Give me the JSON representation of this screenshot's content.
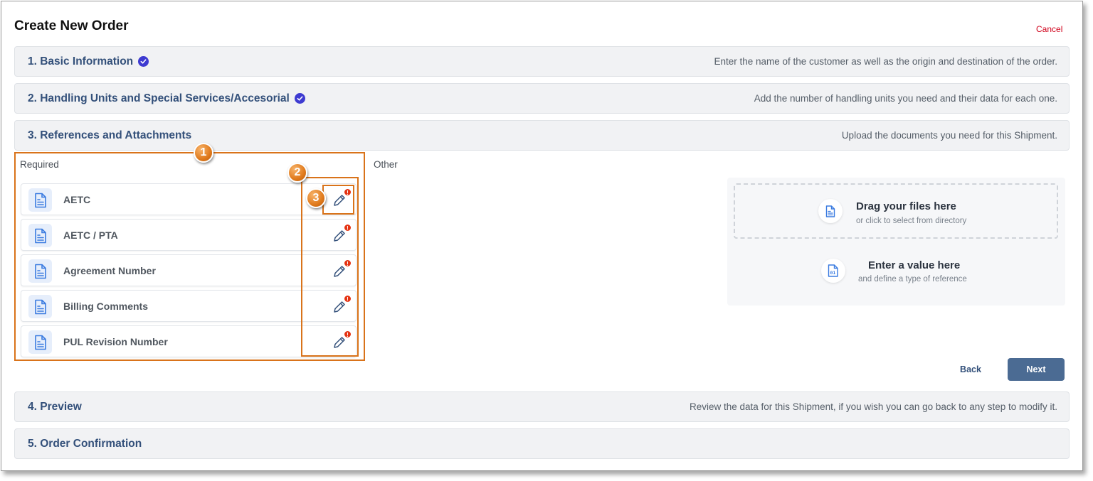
{
  "header": {
    "title": "Create New Order",
    "cancel_label": "Cancel"
  },
  "steps": [
    {
      "label": "1. Basic Information",
      "description": "Enter the name of the customer as well as the origin and destination of the order.",
      "completed": true
    },
    {
      "label": "2. Handling Units and Special Services/Accesorial",
      "description": "Add the number of handling units you need and their data for each one.",
      "completed": true
    },
    {
      "label": "3. References and Attachments",
      "description": "Upload the documents you need for this Shipment.",
      "completed": false
    },
    {
      "label": "4. Preview",
      "description": "Review the data for this Shipment, if you wish you can go back to any step to modify it.",
      "completed": false
    },
    {
      "label": "5. Order Confirmation",
      "description": "",
      "completed": false
    }
  ],
  "required": {
    "label": "Required",
    "items": [
      {
        "label": "AETC",
        "icon": "document-icon",
        "alert": "!"
      },
      {
        "label": "AETC / PTA",
        "icon": "document-icon",
        "alert": "!"
      },
      {
        "label": "Agreement Number",
        "icon": "document-icon",
        "alert": "!"
      },
      {
        "label": "Billing Comments",
        "icon": "document-icon",
        "alert": "!"
      },
      {
        "label": "PUL Revision Number",
        "icon": "document-icon",
        "alert": "!"
      }
    ]
  },
  "other": {
    "label": "Other",
    "dropzone": {
      "title": "Drag your files here",
      "subtitle": "or click to select from directory",
      "icon": "file-icon"
    },
    "value_option": {
      "title": "Enter a value here",
      "subtitle": "and define a type of reference",
      "icon": "binary-file-icon"
    }
  },
  "actions": {
    "back_label": "Back",
    "next_label": "Next"
  },
  "callouts": [
    "1",
    "2",
    "3"
  ],
  "colors": {
    "accent": "#33507a",
    "check": "#3e3bd1",
    "alert": "#e53212",
    "cancel": "#d0021b",
    "next_bg": "#4b6b93",
    "callout": "#d9731a"
  }
}
